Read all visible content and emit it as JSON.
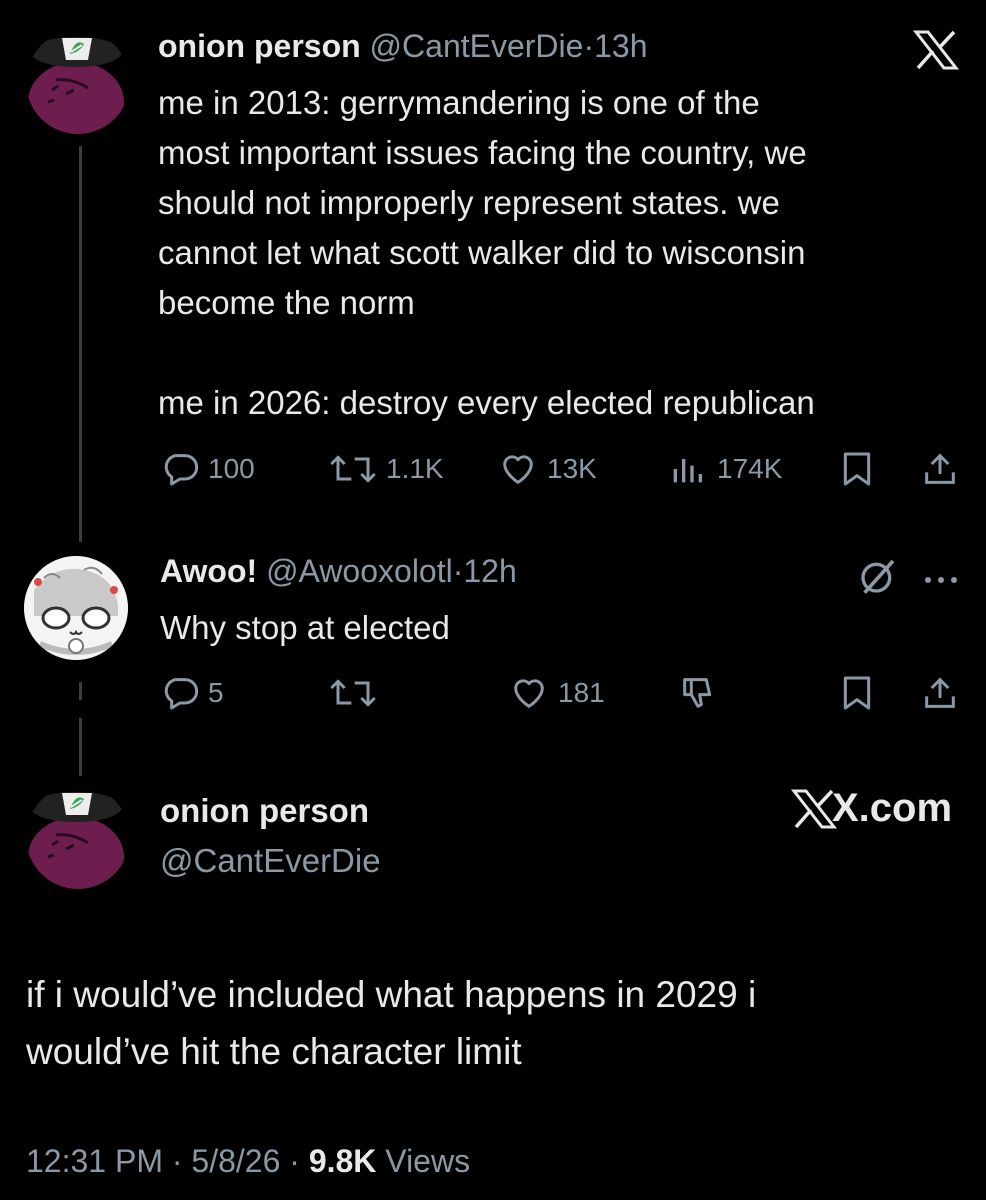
{
  "colors": {
    "background": "#000000",
    "text": "#e7e9ea",
    "muted": "#8b98a5",
    "onion_purple": "#6d1e4f"
  },
  "tweet1": {
    "author_name": "onion person",
    "handle": "@CantEverDie",
    "separator": "·",
    "time": "13h",
    "logo_icon": "x-logo-icon",
    "text_lines": [
      "me in 2013:  gerrymandering is one of the",
      "most important issues facing the country, we",
      "should not improperly represent states.  we",
      "cannot let what scott walker did to wisconsin",
      "become the norm"
    ],
    "text_line_2026": "me in 2026:  destroy every elected republican",
    "actions": {
      "replies": "100",
      "reposts": "1.1K",
      "likes": "13K",
      "views": "174K"
    }
  },
  "tweet2": {
    "author_name": "Awoo!",
    "handle": "@Awooxolotl",
    "separator": "·",
    "time": "12h",
    "text": "Why stop at elected",
    "actions": {
      "replies": "5",
      "likes": "181"
    }
  },
  "tweet3": {
    "author_name": "onion person",
    "handle": "@CantEverDie",
    "brand": "X.com",
    "text_lines": [
      "if i would’ve included what happens in 2029 i",
      "would’ve hit the character limit"
    ],
    "meta": {
      "time": "12:31 PM",
      "sep1": "·",
      "date": "5/8/26",
      "sep2": "·",
      "views_count": "9.8K",
      "views_label": "Views"
    }
  }
}
